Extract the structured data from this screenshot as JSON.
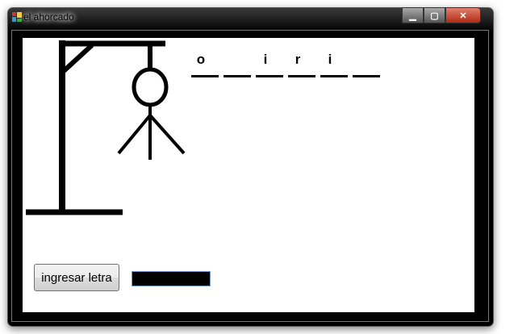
{
  "window": {
    "title": "el ahorcado",
    "icon": "app-icon",
    "controls": [
      "minimize-icon",
      "maximize-icon",
      "close-icon"
    ]
  },
  "word": {
    "slots": [
      "o",
      "",
      "i",
      "r",
      "i",
      ""
    ]
  },
  "input": {
    "button_label": "ingresar letra",
    "value": ""
  },
  "colors": {
    "client": "#ffffff",
    "frame": "#000000",
    "textbox": "#000000"
  }
}
